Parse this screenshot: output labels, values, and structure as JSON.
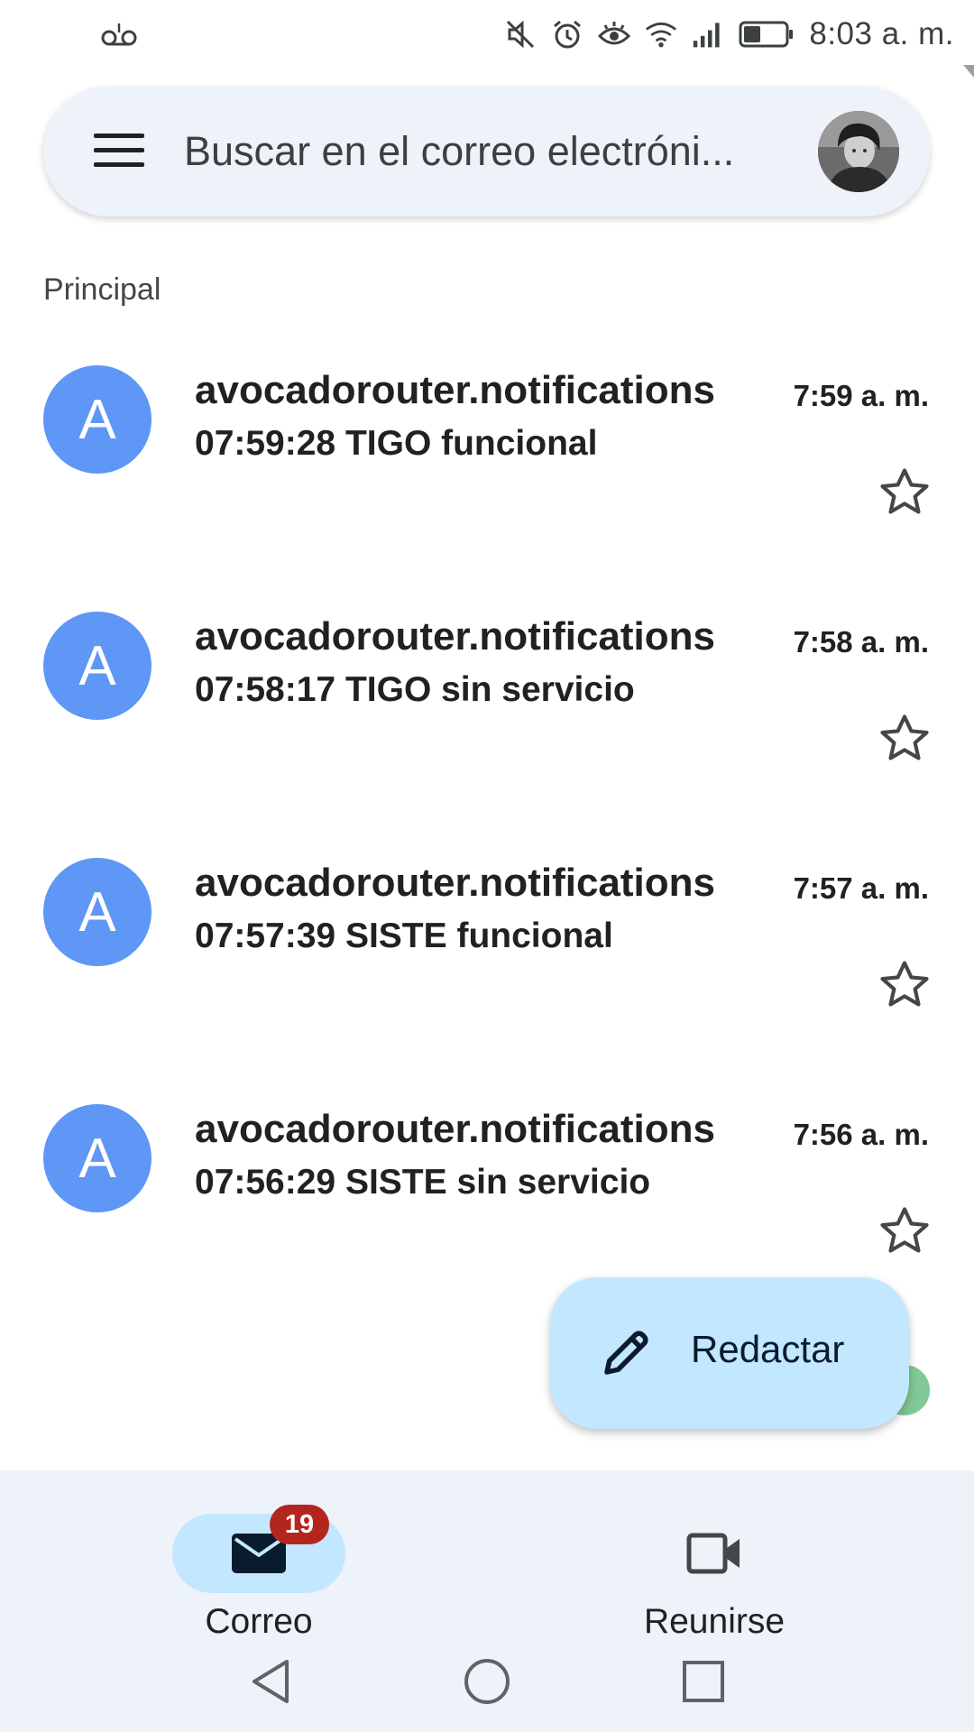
{
  "status_bar": {
    "time": "8:03 a. m.",
    "icons": [
      "voicemail-icon",
      "mute-icon",
      "alarm-icon",
      "eye-comfort-icon",
      "wifi-icon",
      "signal-icon",
      "battery-icon"
    ]
  },
  "search": {
    "placeholder": "Buscar en el correo electróni..."
  },
  "section_label": "Principal",
  "emails": [
    {
      "avatar_letter": "A",
      "sender": "avocadorouter.notifications",
      "subject": "07:59:28 TIGO funcional",
      "time": "7:59 a. m."
    },
    {
      "avatar_letter": "A",
      "sender": "avocadorouter.notifications",
      "subject": "07:58:17 TIGO sin servicio",
      "time": "7:58 a. m."
    },
    {
      "avatar_letter": "A",
      "sender": "avocadorouter.notifications",
      "subject": "07:57:39 SISTE funcional",
      "time": "7:57 a. m."
    },
    {
      "avatar_letter": "A",
      "sender": "avocadorouter.notifications",
      "subject": "07:56:29 SISTE sin servicio",
      "time": "7:56 a. m."
    }
  ],
  "compose": {
    "label": "Redactar"
  },
  "bottom_nav": {
    "mail": {
      "label": "Correo",
      "badge": "19"
    },
    "meet": {
      "label": "Reunirse"
    }
  },
  "colors": {
    "avatar_blue": "#5e97f6",
    "search_bg": "#eef2f9",
    "active_pill": "#c2e7ff",
    "badge_red": "#b3261e"
  }
}
